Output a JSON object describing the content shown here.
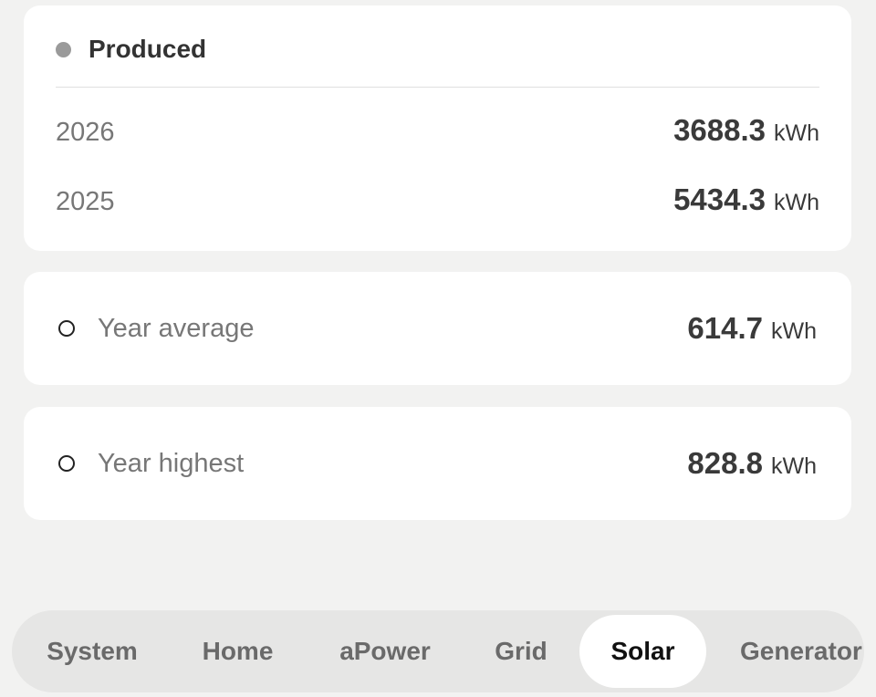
{
  "produced": {
    "title": "Produced",
    "rows": [
      {
        "year": "2026",
        "value": "3688.3",
        "unit": "kWh"
      },
      {
        "year": "2025",
        "value": "5434.3",
        "unit": "kWh"
      }
    ]
  },
  "average": {
    "label": "Year average",
    "value": "614.7",
    "unit": "kWh"
  },
  "highest": {
    "label": "Year highest",
    "value": "828.8",
    "unit": "kWh"
  },
  "tabs": [
    {
      "label": "System",
      "active": false
    },
    {
      "label": "Home",
      "active": false
    },
    {
      "label": "aPower",
      "active": false
    },
    {
      "label": "Grid",
      "active": false
    },
    {
      "label": "Solar",
      "active": true
    },
    {
      "label": "Generator",
      "active": false
    }
  ],
  "colors": {
    "background": "#f2f2f1",
    "card": "#ffffff",
    "produced_dot": "#9a9a9a",
    "tabbar": "#e6e6e5",
    "active_tab": "#ffffff"
  }
}
